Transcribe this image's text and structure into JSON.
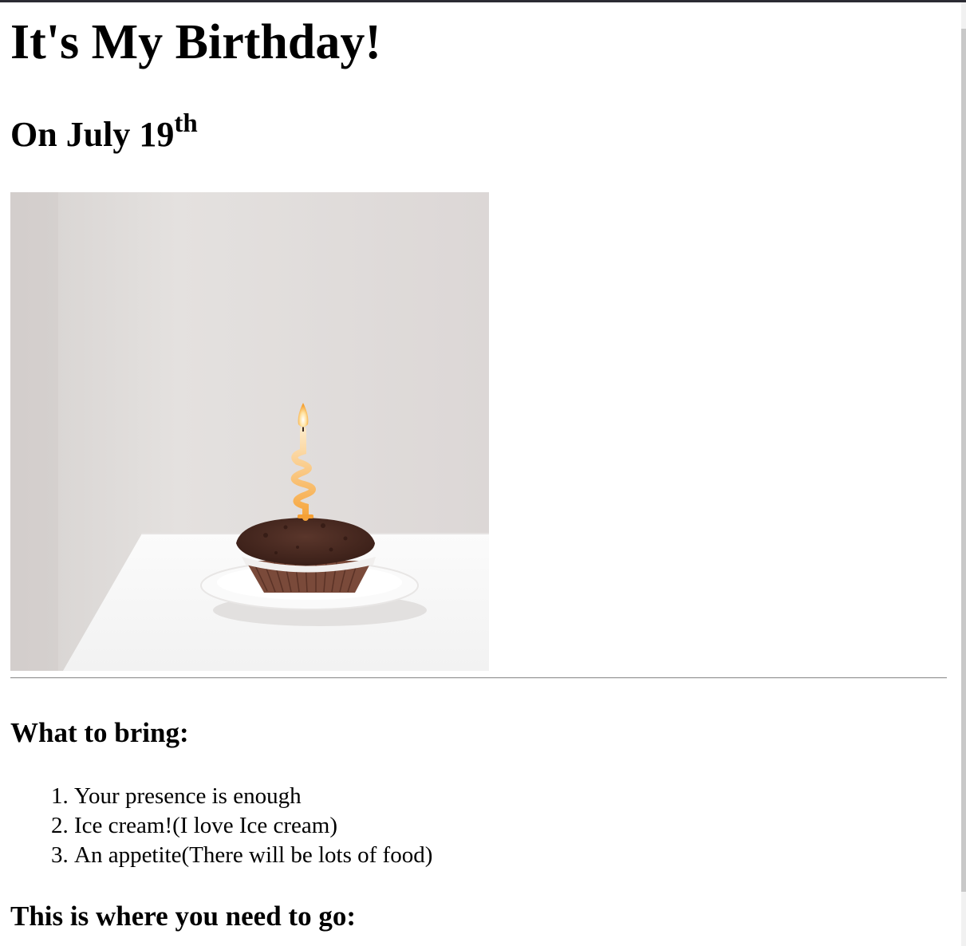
{
  "page": {
    "title": "It's My Birthday!",
    "date_prefix": "On July 19",
    "date_suffix": "th"
  },
  "image": {
    "subject": "chocolate cupcake with lit spiral candle on a white plate"
  },
  "bring_section": {
    "heading": "What to bring:",
    "items": [
      "Your presence is enough",
      "Ice cream!(I love Ice cream)",
      "An appetite(There will be lots of food)"
    ]
  },
  "where_section": {
    "heading": "This is where you need to go:"
  },
  "colors": {
    "text": "#000000",
    "background": "#ffffff",
    "wall": "#e0dcda",
    "table": "#f7f7f7",
    "cupcake": "#4a2a22",
    "candle": "#f5b25a"
  }
}
